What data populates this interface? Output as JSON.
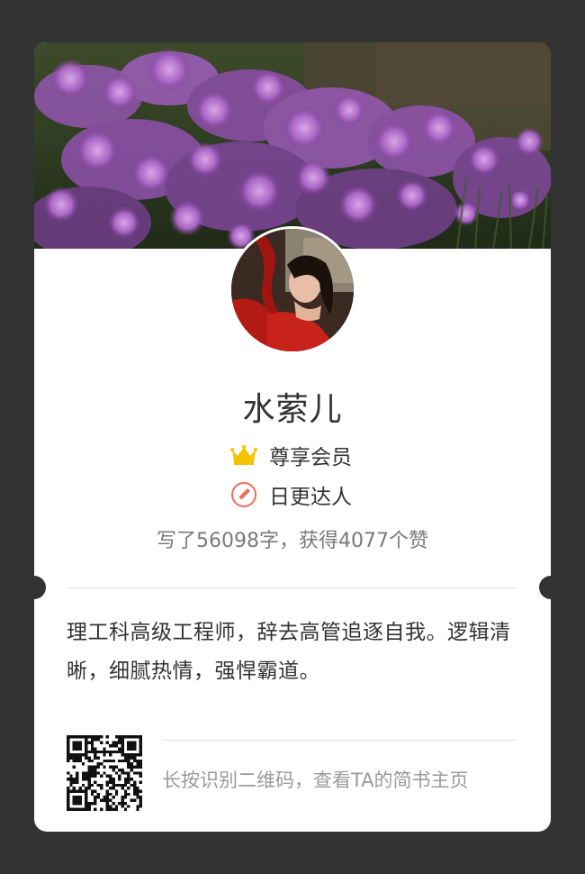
{
  "profile": {
    "name": "水萦儿",
    "badges": {
      "vip": {
        "label": "尊享会员",
        "icon": "crown-icon",
        "color": "#f5c400"
      },
      "daily": {
        "label": "日更达人",
        "icon": "pen-icon",
        "color": "#ea6f5a"
      }
    },
    "stats": "写了56098字，获得4077个赞",
    "bio": "理工科高级工程师，辞去高管追逐自我。逻辑清晰，细腻热情，强悍霸道。"
  },
  "qr": {
    "hint": "长按识别二维码，查看TA的简书主页"
  },
  "colors": {
    "background": "#333333",
    "card": "#ffffff"
  }
}
